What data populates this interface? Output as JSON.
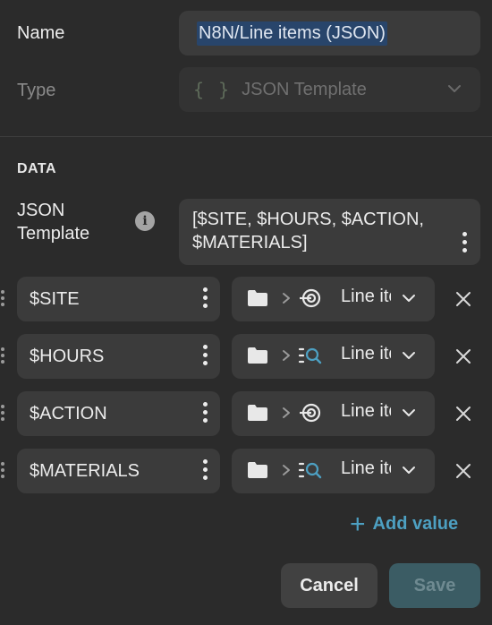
{
  "form": {
    "name_label": "Name",
    "name_value": "N8N/Line items (JSON)",
    "type_label": "Type",
    "type_icon": "{ }",
    "type_value": "JSON Template"
  },
  "data_section": {
    "title": "DATA",
    "json_template_label": "JSON Template",
    "info_icon": "i",
    "json_template_value": "[$SITE, $HOURS, $ACTION, $MATERIALS]"
  },
  "variables": [
    {
      "name": "$SITE",
      "path_icon": "target-icon",
      "path_label": "Line items"
    },
    {
      "name": "$HOURS",
      "path_icon": "list-search-icon",
      "path_label": "Line items"
    },
    {
      "name": "$ACTION",
      "path_icon": "target-icon",
      "path_label": "Line items"
    },
    {
      "name": "$MATERIALS",
      "path_icon": "list-search-icon",
      "path_label": "Line items"
    }
  ],
  "actions": {
    "add_value": "Add value",
    "add_icon": "+",
    "cancel": "Cancel",
    "save": "Save"
  },
  "colors": {
    "background": "#2b2b2b",
    "input": "#3b3b3b",
    "accent": "#4da0c2",
    "selection": "#28456b",
    "save_disabled": "#3b5c64"
  }
}
